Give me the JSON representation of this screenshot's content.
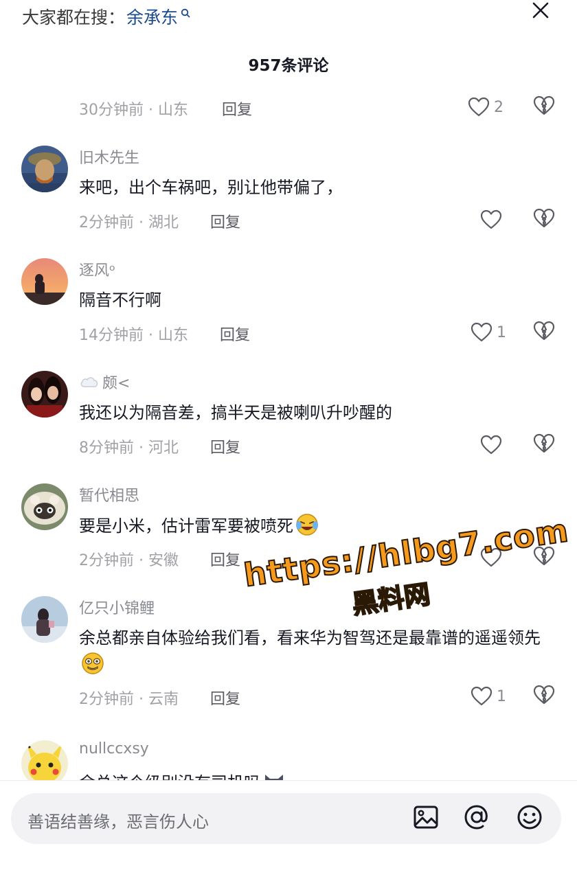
{
  "header": {
    "hot_label": "大家都在搜：",
    "hot_keyword": "余承东",
    "comment_count": "957条评论"
  },
  "comments": [
    {
      "meta": "30分钟前 · 山东",
      "reply": "回复",
      "likes": "2"
    },
    {
      "username": "旧木先生",
      "text": "来吧，出个车祸吧，别让他带偏了，",
      "meta": "2分钟前 · 湖北",
      "reply": "回复",
      "likes": ""
    },
    {
      "username": "逐风ᵒ",
      "text": "隔音不行啊",
      "meta": "14分钟前 · 山东",
      "reply": "回复",
      "likes": "1"
    },
    {
      "username": "颇<",
      "text": "我还以为隔音差，搞半天是被喇叭升吵醒的",
      "meta": "8分钟前 · 河北",
      "reply": "回复",
      "likes": ""
    },
    {
      "username": "暂代相思",
      "text": "要是小米，估计雷军要被喷死",
      "meta": "2分钟前 · 安徽",
      "reply": "回复",
      "likes": ""
    },
    {
      "username": "亿只小锦鲤",
      "text": "余总都亲自体验给我们看，看来华为智驾还是最靠谱的遥遥领先",
      "meta": "2分钟前 · 云南",
      "reply": "回复",
      "likes": "1"
    },
    {
      "username": "nullccxsy",
      "text": "余总这个级别没有司机吗"
    }
  ],
  "watermark": {
    "url": "https://hlbg7.com",
    "name": "黑料网"
  },
  "input": {
    "placeholder": "善语结善缘，恶言伤人心"
  },
  "icons": {
    "close": "close-icon",
    "image": "image-icon",
    "mention": "at-icon",
    "emoji": "emoji-icon",
    "like": "heart-icon",
    "dislike": "broken-heart-icon"
  }
}
